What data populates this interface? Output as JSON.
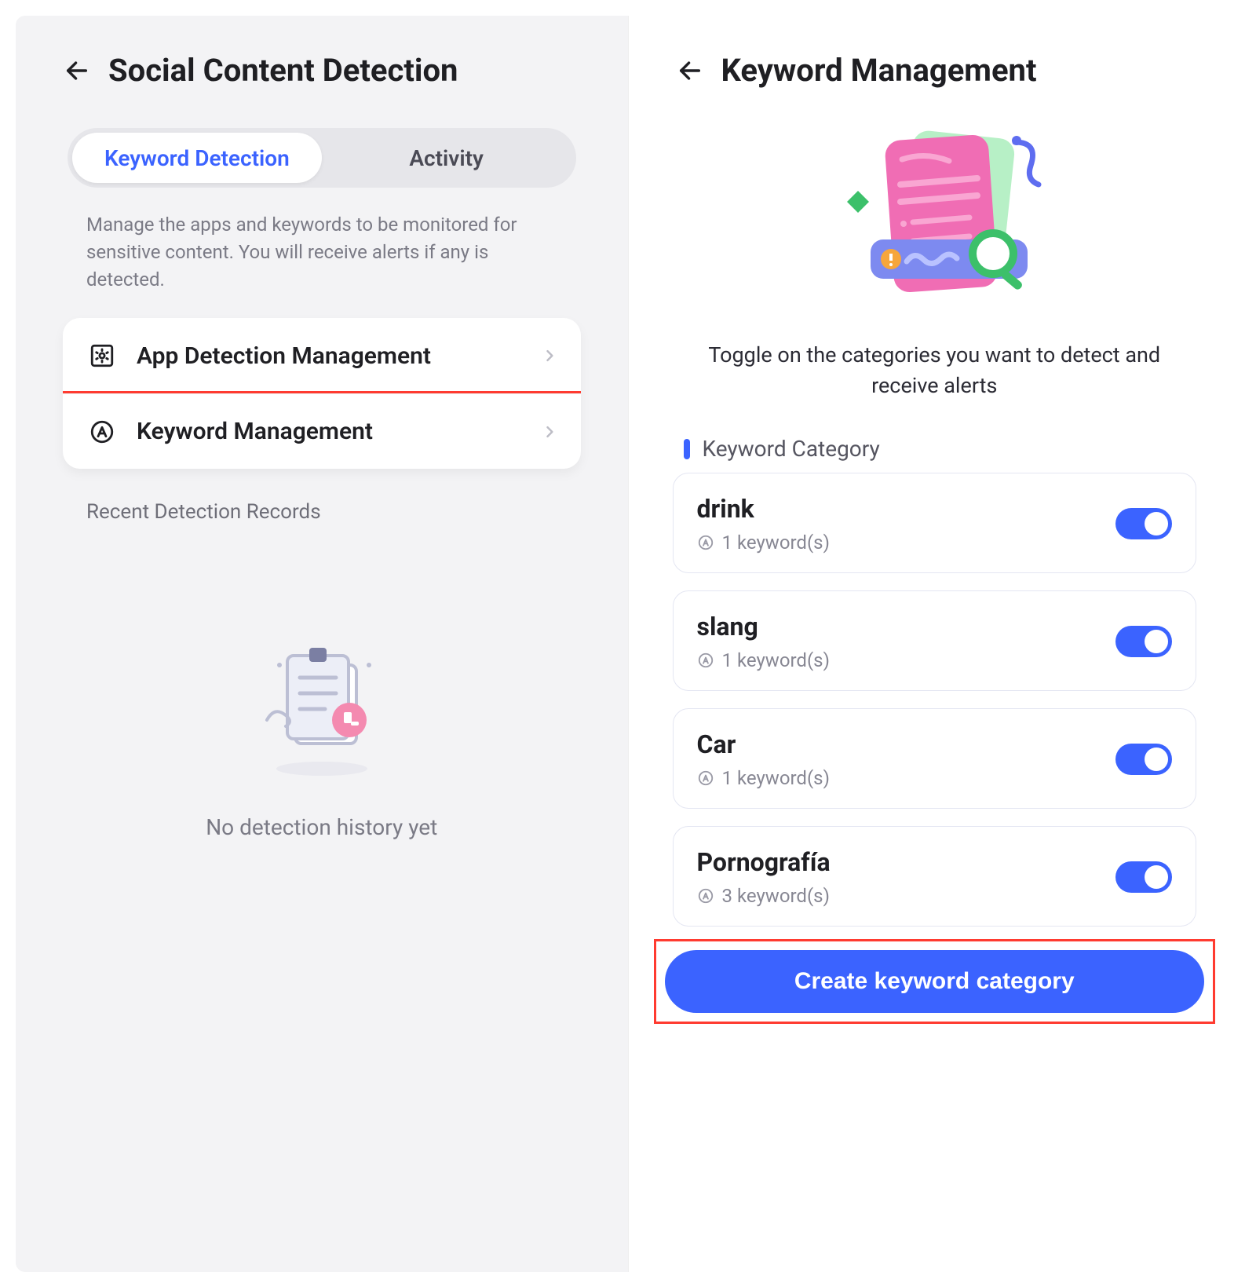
{
  "left": {
    "title": "Social Content Detection",
    "tabs": {
      "keyword_detection": "Keyword Detection",
      "activity": "Activity"
    },
    "description": "Manage the apps and keywords to be monitored for sensitive content. You will receive alerts if any is detected.",
    "items": {
      "app_detection": "App Detection Management",
      "keyword_management": "Keyword Management"
    },
    "records_label": "Recent Detection Records",
    "empty_text": "No detection history yet"
  },
  "right": {
    "title": "Keyword Management",
    "hero_desc": "Toggle on the categories you want to detect and receive alerts",
    "section_title": "Keyword Category",
    "categories": [
      {
        "name": "drink",
        "count": "1 keyword(s)",
        "enabled": true
      },
      {
        "name": "slang",
        "count": "1 keyword(s)",
        "enabled": true
      },
      {
        "name": "Car",
        "count": "1 keyword(s)",
        "enabled": true
      },
      {
        "name": "Pornografía",
        "count": "3 keyword(s)",
        "enabled": true
      }
    ],
    "create_button": "Create keyword category"
  }
}
